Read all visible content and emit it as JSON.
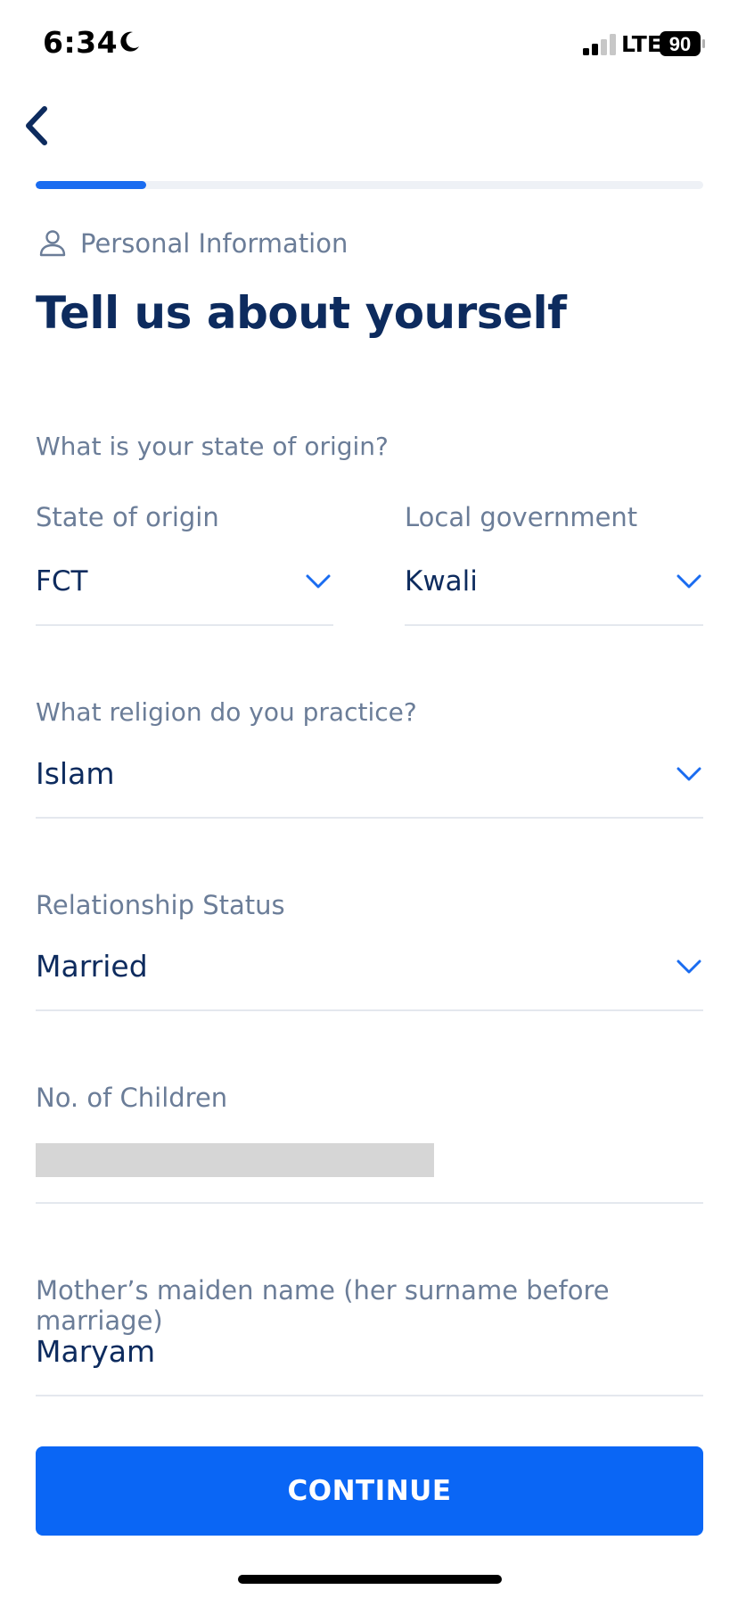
{
  "status_bar": {
    "time": "6:34",
    "network": "LTE",
    "battery": "90"
  },
  "progress": {
    "fraction": 0.165
  },
  "header": {
    "section_label": "Personal Information",
    "title": "Tell us about yourself"
  },
  "origin": {
    "question": "What is your state of origin?",
    "state_label": "State of origin",
    "state_value": "FCT",
    "lga_label": "Local government",
    "lga_value": "Kwali"
  },
  "religion": {
    "question": "What religion do you practice?",
    "value": "Islam"
  },
  "relationship": {
    "label": "Relationship Status",
    "value": "Married"
  },
  "children": {
    "label": "No. of Children"
  },
  "maiden": {
    "label": "Mother’s maiden name (her surname before marriage)",
    "value": "Maryam"
  },
  "actions": {
    "continue_label": "CONTINUE"
  },
  "icons": {
    "back": "chevron-left-icon",
    "section": "person-icon",
    "dropdown": "chevron-down-icon"
  },
  "colors": {
    "accent": "#0a66f5",
    "title": "#0d2b5e",
    "muted": "#6b7d98"
  }
}
